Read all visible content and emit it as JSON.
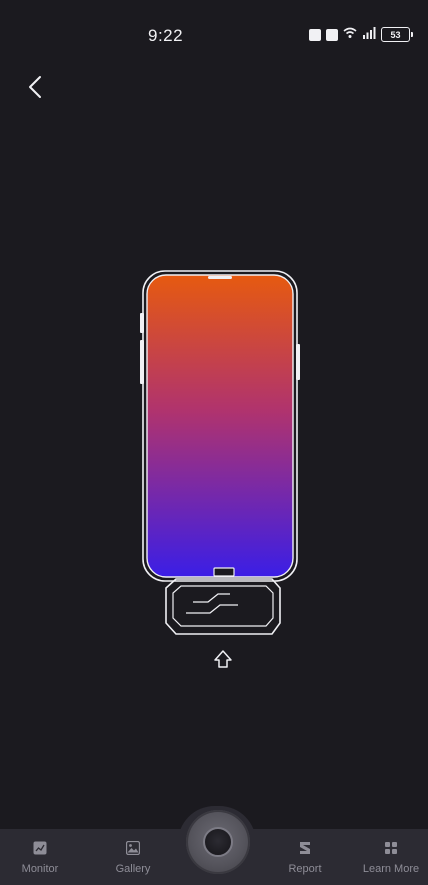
{
  "status_bar": {
    "time": "9:22",
    "battery": "53"
  },
  "device_graphic": {
    "gradient_top": "#e65a10",
    "gradient_mid": "#b0336e",
    "gradient_bottom": "#3b1ee6",
    "outline_color": "#f0f0f4"
  },
  "bottom_nav": {
    "items": [
      {
        "label": "Monitor",
        "icon": "monitor-icon"
      },
      {
        "label": "Gallery",
        "icon": "gallery-icon"
      },
      {
        "label": "Report",
        "icon": "report-icon"
      },
      {
        "label": "Learn More",
        "icon": "learn-more-icon"
      }
    ],
    "capture_icon": "camera-shutter-icon"
  },
  "colors": {
    "background": "#1b1a1f",
    "nav_background": "#2c2b33",
    "nav_label": "#8e8d97"
  }
}
